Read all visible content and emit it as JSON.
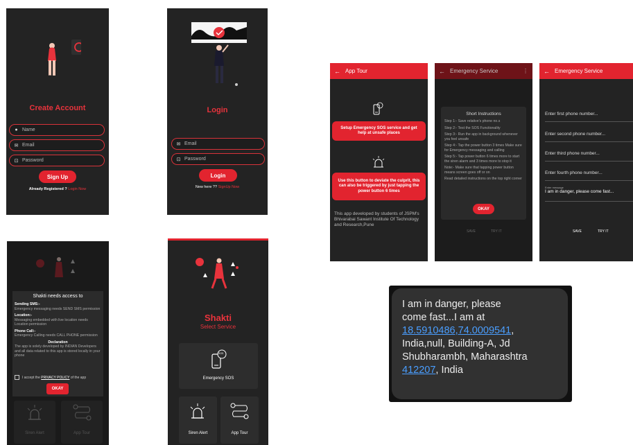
{
  "create_account": {
    "title": "Create Account",
    "name_placeholder": "Name",
    "email_placeholder": "Email",
    "password_placeholder": "Password",
    "signup_button": "Sign Up",
    "already_text": "Already Registered ?",
    "login_link": "Login Now"
  },
  "login": {
    "title": "Login",
    "email_placeholder": "Email",
    "password_placeholder": "Password",
    "login_button": "Login",
    "new_text": "New here ??",
    "signup_link": "SignUp Now"
  },
  "app_tour": {
    "appbar_title": "App Tour",
    "card1_text": "Setup Emergency SOS service and get help at unsafe places",
    "card2_text": "Use this button to deviate the culprit, this can also be triggered by just tapping the power button 6 times",
    "footer_text": "This app developed by students of JSPM's Bhivarabai Sawant Institute Of Technology and Research,Pune"
  },
  "instructions": {
    "appbar_title": "Emergency Service",
    "dialog_title": "Short Instructions",
    "steps": [
      "Step 1:- Save relative's phone no.s",
      "Step 2:- Test the SOS Functionality",
      "Step 3:- Run the app in background whenever you feel unsafe",
      "Step 4:- Tap the power button 3 times Make sure for Emergency messaging and calling",
      "Step 5:- Tap power button 6 times more to start the siren alarm and 3 times more to stop it",
      "Note:- Make sure that tapping power button means screen goes off or on",
      "Read detailed instructions on the top right corner"
    ],
    "okay_button": "OKAY",
    "save_label": "SAVE",
    "try_label": "TRY IT"
  },
  "emergency_form": {
    "appbar_title": "Emergency Service",
    "phone1_placeholder": "Enter first phone number...",
    "phone2_placeholder": "Enter second phone number...",
    "phone3_placeholder": "Enter third phone number...",
    "phone4_placeholder": "Enter fourth phone number...",
    "message_label": "Enter message",
    "message_value": "I am in danger, please come fast...",
    "save_button": "SAVE",
    "try_button": "TRY IT"
  },
  "permissions": {
    "dialog_title": "Shakti needs access to",
    "sms_heading": "Sending SMS:-",
    "sms_text": "Emergency messaging needs SEND SMS permission",
    "location_heading": "Location:-",
    "location_text": "Messaging embedded with live location needs Location permission",
    "call_heading": "Phone Call:-",
    "call_text": "Emergency Calling needs CALL PHONE permission",
    "declaration_heading": "Declaration",
    "declaration_text": "The app is solely developed by INDIAN Developers and all data related to this app is stored locally in your phone",
    "accept_prefix": "I accept the",
    "policy_link": "PRIVACY POLICY",
    "accept_suffix": "of the app",
    "okay_button": "OKAY",
    "siren_label": "Siren Alert",
    "tour_label": "App Tour"
  },
  "home": {
    "title": "Shakti",
    "subtitle": "Select Service",
    "sos_badge": "SOS",
    "sos_label": "Emergency SOS",
    "siren_label": "Siren Alert",
    "tour_label": "App Tour"
  },
  "sms": {
    "line1": "I am in danger, please",
    "line2": "come fast...I am at",
    "coords": "18.5910486,74.0009541",
    "after_coords": ",",
    "line4": "India,null, Building-A, Jd",
    "line5": "Shubharambh, Maharashtra",
    "pincode": "412207",
    "after_pin": ", India"
  },
  "colors": {
    "accent_red": "#e2242f",
    "screen_bg": "#232323",
    "link_blue": "#4a9eff"
  }
}
